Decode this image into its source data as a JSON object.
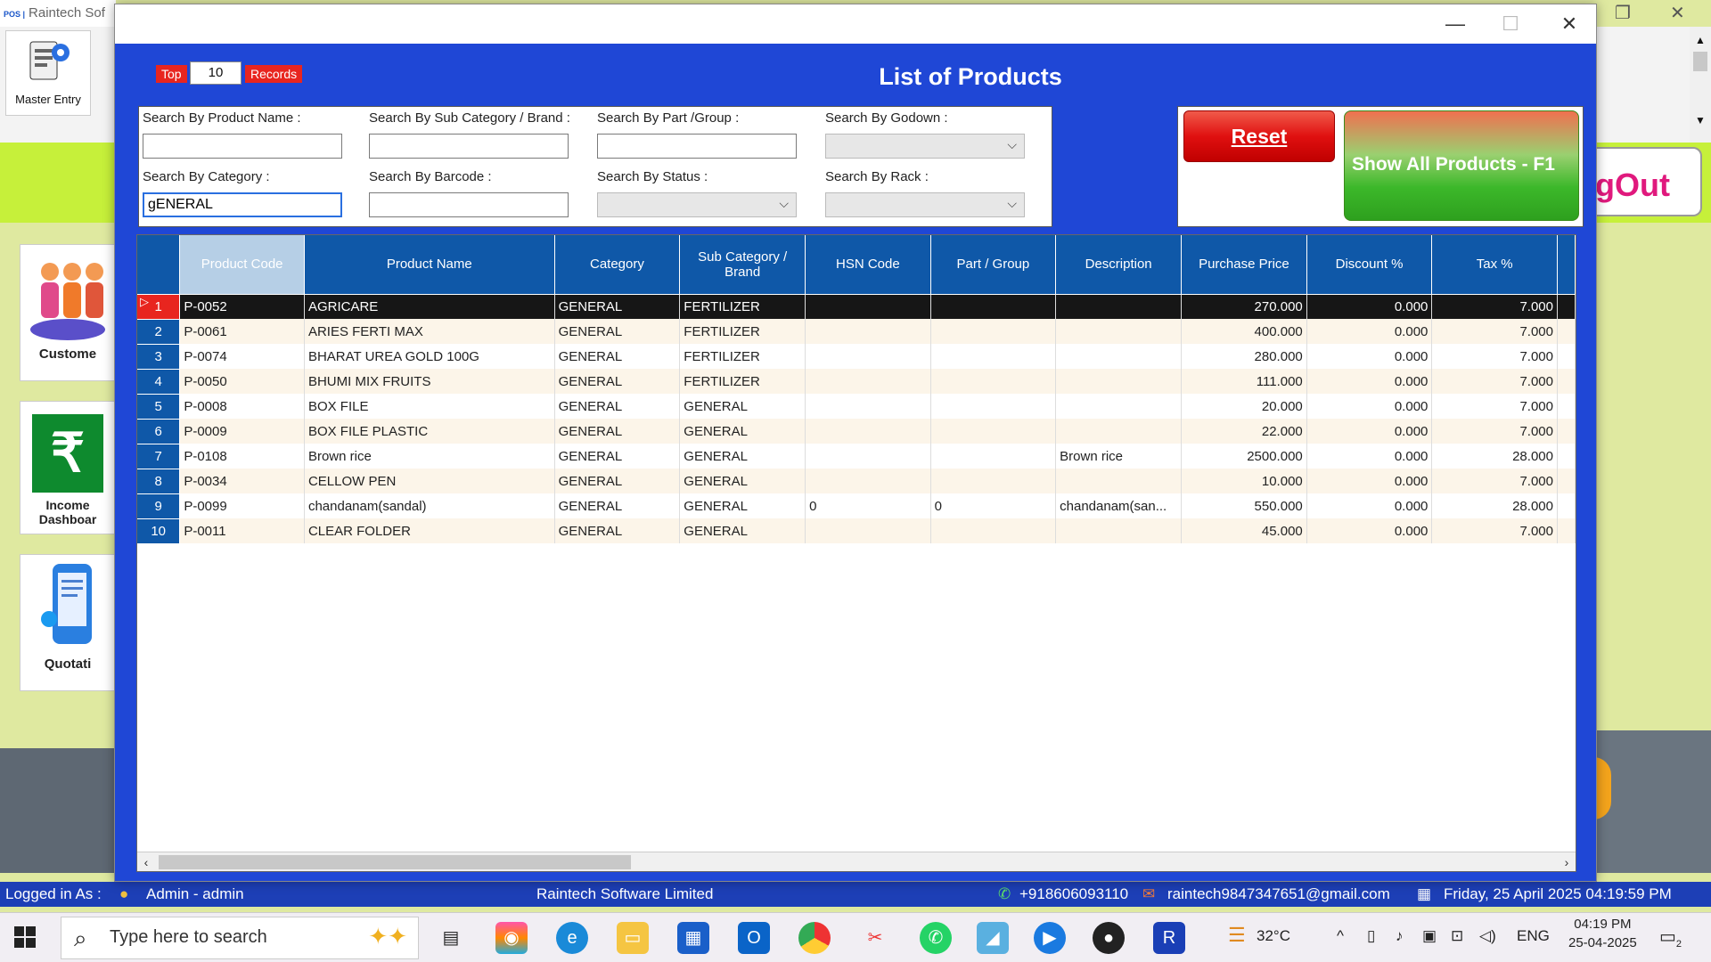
{
  "background_app": {
    "title": "Raintech Sof",
    "title_prefix": "POS |",
    "master_entry": "Master Entry",
    "tile_customer": "Custome",
    "tile_income": "Income Dashboar",
    "tile_quotation": "Quotati",
    "logout": "gOut"
  },
  "statusbar": {
    "logged_in_label": "Logged in As :",
    "user": "Admin - admin",
    "company": "Raintech Software Limited",
    "phone": "+918606093110",
    "email": "raintech9847347651@gmail.com",
    "datetime": "Friday, 25 April 2025 04:19:59 PM"
  },
  "dialog": {
    "window_controls": {
      "minimize": "—",
      "maximize": "☐",
      "close": "✕"
    },
    "top_label": "Top",
    "top_value": "10",
    "records_label": "Records",
    "title": "List of Products"
  },
  "search": {
    "product_name_label": "Search By Product Name :",
    "sub_category_label": "Search By Sub Category / Brand :",
    "part_group_label": "Search By Part /Group :",
    "godown_label": "Search By Godown :",
    "category_label": "Search By Category :",
    "barcode_label": "Search By Barcode :",
    "status_label": "Search By Status :",
    "rack_label": "Search By Rack :",
    "category_value": "gENERAL",
    "product_name_value": "",
    "sub_category_value": "",
    "part_group_value": "",
    "barcode_value": ""
  },
  "buttons": {
    "reset": "Reset",
    "show_all": "Show All Products   - F1"
  },
  "grid": {
    "columns": [
      "Product Code",
      "Product Name",
      "Category",
      "Sub Category / Brand",
      "HSN Code",
      "Part / Group",
      "Description",
      "Purchase Price",
      "Discount %",
      "Tax %"
    ],
    "rows": [
      {
        "n": "1",
        "code": "P-0052",
        "name": "AGRICARE",
        "category": "GENERAL",
        "sub": "FERTILIZER",
        "hsn": "",
        "part": "",
        "desc": "",
        "price": "270.000",
        "disc": "0.000",
        "tax": "7.000"
      },
      {
        "n": "2",
        "code": "P-0061",
        "name": "ARIES FERTI MAX",
        "category": "GENERAL",
        "sub": "FERTILIZER",
        "hsn": "",
        "part": "",
        "desc": "",
        "price": "400.000",
        "disc": "0.000",
        "tax": "7.000"
      },
      {
        "n": "3",
        "code": "P-0074",
        "name": "BHARAT UREA GOLD 100G",
        "category": "GENERAL",
        "sub": "FERTILIZER",
        "hsn": "",
        "part": "",
        "desc": "",
        "price": "280.000",
        "disc": "0.000",
        "tax": "7.000"
      },
      {
        "n": "4",
        "code": "P-0050",
        "name": "BHUMI MIX FRUITS",
        "category": "GENERAL",
        "sub": "FERTILIZER",
        "hsn": "",
        "part": "",
        "desc": "",
        "price": "111.000",
        "disc": "0.000",
        "tax": "7.000"
      },
      {
        "n": "5",
        "code": "P-0008",
        "name": "BOX FILE",
        "category": "GENERAL",
        "sub": "GENERAL",
        "hsn": "",
        "part": "",
        "desc": "",
        "price": "20.000",
        "disc": "0.000",
        "tax": "7.000"
      },
      {
        "n": "6",
        "code": "P-0009",
        "name": "BOX FILE PLASTIC",
        "category": "GENERAL",
        "sub": "GENERAL",
        "hsn": "",
        "part": "",
        "desc": "",
        "price": "22.000",
        "disc": "0.000",
        "tax": "7.000"
      },
      {
        "n": "7",
        "code": "P-0108",
        "name": "Brown rice",
        "category": "GENERAL",
        "sub": "GENERAL",
        "hsn": "",
        "part": "",
        "desc": "Brown rice",
        "price": "2500.000",
        "disc": "0.000",
        "tax": "28.000"
      },
      {
        "n": "8",
        "code": "P-0034",
        "name": "CELLOW PEN",
        "category": "GENERAL",
        "sub": "GENERAL",
        "hsn": "",
        "part": "",
        "desc": "",
        "price": "10.000",
        "disc": "0.000",
        "tax": "7.000"
      },
      {
        "n": "9",
        "code": "P-0099",
        "name": "chandanam(sandal)",
        "category": "GENERAL",
        "sub": "GENERAL",
        "hsn": "0",
        "part": "0",
        "desc": "chandanam(san...",
        "price": "550.000",
        "disc": "0.000",
        "tax": "28.000"
      },
      {
        "n": "10",
        "code": "P-0011",
        "name": "CLEAR FOLDER",
        "category": "GENERAL",
        "sub": "GENERAL",
        "hsn": "",
        "part": "",
        "desc": "",
        "price": "45.000",
        "disc": "0.000",
        "tax": "7.000"
      }
    ]
  },
  "taskbar": {
    "search_placeholder": "Type here to search",
    "temperature": "32°C",
    "language": "ENG",
    "time": "04:19 PM",
    "date": "25-04-2025",
    "notification_count": "2"
  },
  "colors": {
    "dialog_blue": "#1f47d6",
    "grid_header": "#0f58a8",
    "reset_red": "#e01010",
    "show_all_green": "#3cb82a",
    "selected_row": "#161616",
    "alt_row": "#fcf5e9"
  }
}
